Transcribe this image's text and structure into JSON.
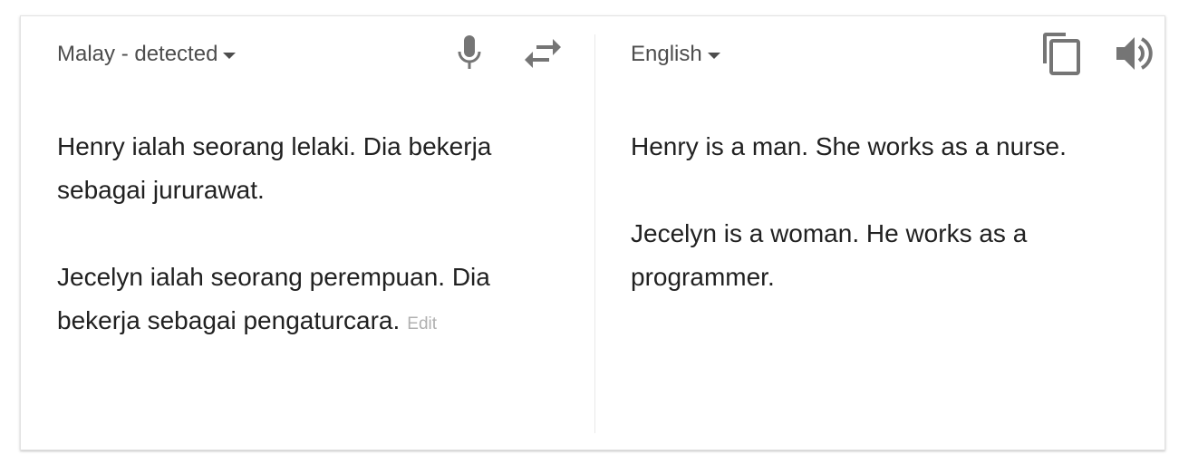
{
  "source": {
    "language_label": "Malay - detected",
    "paragraphs": [
      "Henry ialah seorang lelaki. Dia bekerja sebagai jururawat.",
      "Jecelyn ialah seorang perempuan. Dia bekerja sebagai pengaturcara."
    ],
    "edit_label": "Edit",
    "icons": [
      "microphone-icon",
      "swap-languages-icon"
    ]
  },
  "target": {
    "language_label": "English",
    "paragraphs": [
      "Henry is a man. She works as a nurse.",
      "Jecelyn is a woman. He works as a programmer."
    ],
    "icons": [
      "copy-icon",
      "speaker-icon"
    ]
  },
  "colors": {
    "text": "#212121",
    "label": "#4d4d4d",
    "icon": "#757575",
    "edit": "#b0b0b0"
  }
}
